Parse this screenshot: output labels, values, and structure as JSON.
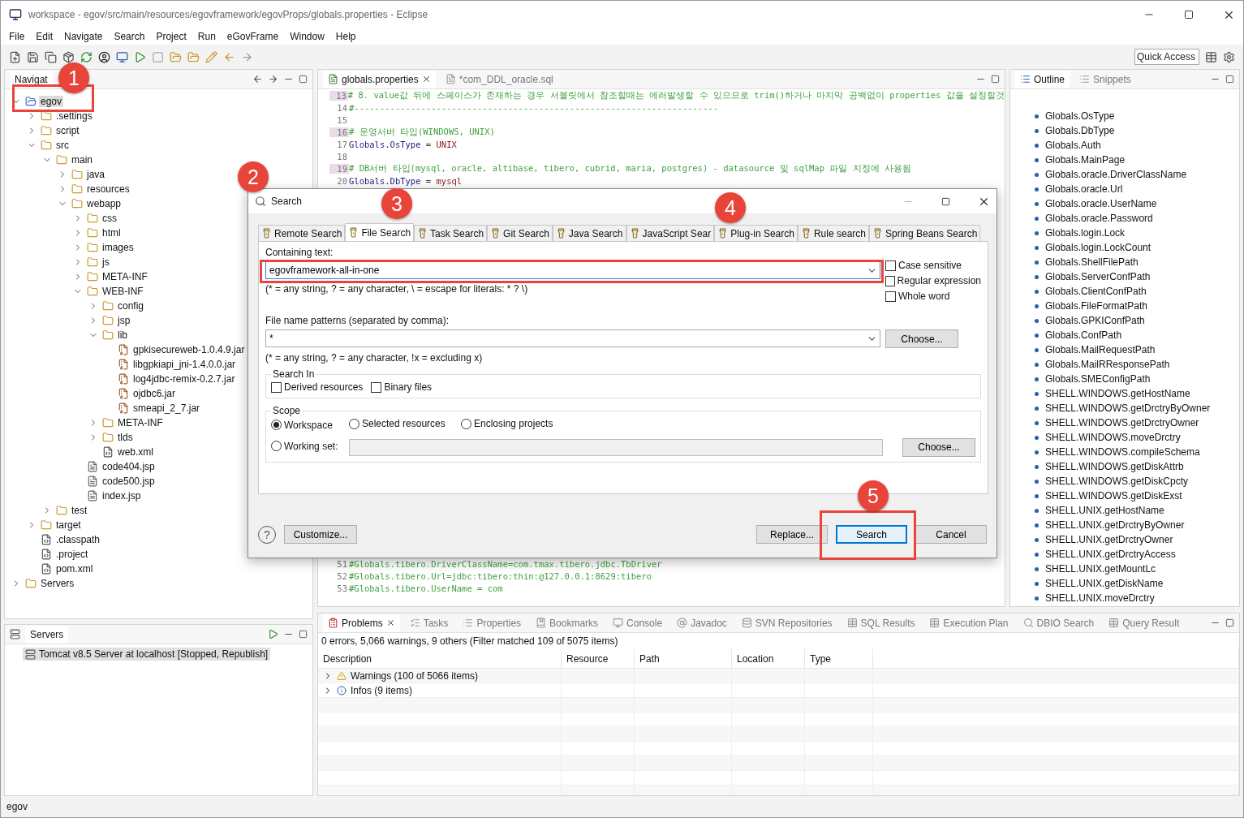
{
  "window": {
    "title": "workspace - egov/src/main/resources/egovframework/egovProps/globals.properties - Eclipse"
  },
  "menu": [
    "File",
    "Edit",
    "Navigate",
    "Search",
    "Project",
    "Run",
    "eGovFrame",
    "Window",
    "Help"
  ],
  "quick_access": {
    "placeholder": "Quick Access"
  },
  "navigator": {
    "tab": "Navigat",
    "tree": [
      {
        "label": "egov",
        "kind": "project",
        "expanded": true,
        "selected": true,
        "children": [
          {
            "label": ".settings",
            "kind": "folder",
            "expanded": false
          },
          {
            "label": "script",
            "kind": "folder",
            "expanded": false
          },
          {
            "label": "src",
            "kind": "folder",
            "expanded": true,
            "children": [
              {
                "label": "main",
                "kind": "folder",
                "expanded": true,
                "children": [
                  {
                    "label": "java",
                    "kind": "folder",
                    "expanded": false
                  },
                  {
                    "label": "resources",
                    "kind": "folder",
                    "expanded": false
                  },
                  {
                    "label": "webapp",
                    "kind": "folder",
                    "expanded": true,
                    "children": [
                      {
                        "label": "css",
                        "kind": "folder",
                        "expanded": false
                      },
                      {
                        "label": "html",
                        "kind": "folder",
                        "expanded": false
                      },
                      {
                        "label": "images",
                        "kind": "folder",
                        "expanded": false
                      },
                      {
                        "label": "js",
                        "kind": "folder",
                        "expanded": false
                      },
                      {
                        "label": "META-INF",
                        "kind": "folder",
                        "expanded": false
                      },
                      {
                        "label": "WEB-INF",
                        "kind": "folder",
                        "expanded": true,
                        "children": [
                          {
                            "label": "config",
                            "kind": "folder",
                            "expanded": false
                          },
                          {
                            "label": "jsp",
                            "kind": "folder",
                            "expanded": false
                          },
                          {
                            "label": "lib",
                            "kind": "folder",
                            "expanded": true,
                            "children": [
                              {
                                "label": "gpkisecureweb-1.0.4.9.jar",
                                "kind": "jar"
                              },
                              {
                                "label": "libgpkiapi_jni-1.4.0.0.jar",
                                "kind": "jar"
                              },
                              {
                                "label": "log4jdbc-remix-0.2.7.jar",
                                "kind": "jar"
                              },
                              {
                                "label": "ojdbc6.jar",
                                "kind": "jar"
                              },
                              {
                                "label": "smeapi_2_7.jar",
                                "kind": "jar"
                              }
                            ]
                          },
                          {
                            "label": "META-INF",
                            "kind": "folder",
                            "expanded": false
                          },
                          {
                            "label": "tlds",
                            "kind": "folder",
                            "expanded": false
                          },
                          {
                            "label": "web.xml",
                            "kind": "xml"
                          }
                        ]
                      },
                      {
                        "label": "code404.jsp",
                        "kind": "file"
                      },
                      {
                        "label": "code500.jsp",
                        "kind": "file"
                      },
                      {
                        "label": "index.jsp",
                        "kind": "file"
                      }
                    ]
                  }
                ]
              },
              {
                "label": "test",
                "kind": "folder",
                "expanded": false
              }
            ]
          },
          {
            "label": "target",
            "kind": "folder",
            "expanded": false
          },
          {
            "label": ".classpath",
            "kind": "xml"
          },
          {
            "label": ".project",
            "kind": "xml"
          },
          {
            "label": "pom.xml",
            "kind": "xml"
          }
        ]
      },
      {
        "label": "Servers",
        "kind": "folder",
        "expanded": false
      }
    ]
  },
  "editor": {
    "tabs": [
      {
        "label": "globals.properties",
        "selected": true
      },
      {
        "label": "*com_DDL_oracle.sql",
        "selected": false
      }
    ],
    "top_lines": [
      {
        "number": "13",
        "kind": "comment",
        "marked": true,
        "text": "#   8.  value값 뒤에 스페이스가 존재하는 경우 서블릿에서 참조할때는 에러발생할 수 있으므로 trim()하거나 마지막 공백없이 properties 값을 설정할것"
      },
      {
        "number": "14",
        "kind": "comment",
        "marked": false,
        "text": "#-----------------------------------------------------------------------"
      },
      {
        "number": "15",
        "kind": "blank",
        "marked": false
      },
      {
        "number": "16",
        "kind": "comment",
        "marked": true,
        "text": "# 운영서버 타입(WINDOWS, UNIX)"
      },
      {
        "number": "17",
        "kind": "property",
        "marked": false,
        "key": "Globals.OsType",
        "sep": " = ",
        "value": "UNIX"
      },
      {
        "number": "18",
        "kind": "blank",
        "marked": false
      },
      {
        "number": "19",
        "kind": "comment",
        "marked": true,
        "text": "# DB서버 타입(mysql, oracle, altibase, tibero, cubrid, maria, postgres) - datasource 및 sqlMap 파일 지정에 사용됨"
      },
      {
        "number": "20",
        "kind": "property",
        "marked": false,
        "key": "Globals.DbType",
        "sep": " = ",
        "value": "mysql"
      }
    ],
    "bottom_lines": [
      {
        "number": "51",
        "kind": "comment",
        "marked": false,
        "text": "#Globals.tibero.DriverClassName=com.tmax.tibero.jdbc.TbDriver"
      },
      {
        "number": "52",
        "kind": "comment",
        "marked": false,
        "text": "#Globals.tibero.Url=jdbc:tibero:thin:@127.0.0.1:8629:tibero"
      },
      {
        "number": "53",
        "kind": "comment",
        "marked": false,
        "text": "#Globals.tibero.UserName = com"
      }
    ]
  },
  "outline": {
    "tabs": [
      {
        "label": "Outline",
        "selected": true
      },
      {
        "label": "Snippets",
        "selected": false
      }
    ],
    "items": [
      "Globals.OsType",
      "Globals.DbType",
      "Globals.Auth",
      "Globals.MainPage",
      "Globals.oracle.DriverClassName",
      "Globals.oracle.Url",
      "Globals.oracle.UserName",
      "Globals.oracle.Password",
      "Globals.login.Lock",
      "Globals.login.LockCount",
      "Globals.ShellFilePath",
      "Globals.ServerConfPath",
      "Globals.ClientConfPath",
      "Globals.FileFormatPath",
      "Globals.GPKIConfPath",
      "Globals.ConfPath",
      "Globals.MailRequestPath",
      "Globals.MailRResponsePath",
      "Globals.SMEConfigPath",
      "SHELL.WINDOWS.getHostName",
      "SHELL.WINDOWS.getDrctryByOwner",
      "SHELL.WINDOWS.getDrctryOwner",
      "SHELL.WINDOWS.moveDrctry",
      "SHELL.WINDOWS.compileSchema",
      "SHELL.WINDOWS.getDiskAttrb",
      "SHELL.WINDOWS.getDiskCpcty",
      "SHELL.WINDOWS.getDiskExst",
      "SHELL.UNIX.getHostName",
      "SHELL.UNIX.getDrctryByOwner",
      "SHELL.UNIX.getDrctryOwner",
      "SHELL.UNIX.getDrctryAccess",
      "SHELL.UNIX.getMountLc",
      "SHELL.UNIX.getDiskName",
      "SHELL.UNIX.moveDrctry"
    ]
  },
  "servers": {
    "tab": "Servers",
    "rows": [
      {
        "label": "Tomcat v8.5 Server at localhost  [Stopped, Republish]",
        "selected": true
      }
    ]
  },
  "problems": {
    "tabs": [
      {
        "label": "Problems",
        "selected": true
      },
      {
        "label": "Tasks",
        "selected": false
      },
      {
        "label": "Properties",
        "selected": false
      },
      {
        "label": "Bookmarks",
        "selected": false
      },
      {
        "label": "Console",
        "selected": false
      },
      {
        "label": "Javadoc",
        "selected": false
      },
      {
        "label": "SVN Repositories",
        "selected": false
      },
      {
        "label": "SQL Results",
        "selected": false
      },
      {
        "label": "Execution Plan",
        "selected": false
      },
      {
        "label": "DBIO Search",
        "selected": false
      },
      {
        "label": "Query Result",
        "selected": false
      }
    ],
    "summary": "0 errors, 5,066 warnings, 9 others (Filter matched 109 of 5075 items)",
    "columns": [
      "Description",
      "Resource",
      "Path",
      "Location",
      "Type"
    ],
    "rows": [
      {
        "kind": "warning",
        "label": "Warnings (100 of 5066 items)",
        "expanded": false
      },
      {
        "kind": "info",
        "label": "Infos (9 items)",
        "expanded": false
      }
    ]
  },
  "dialog": {
    "title": "Search",
    "tabs": [
      {
        "label": "Remote Search",
        "selected": false
      },
      {
        "label": "File Search",
        "selected": true
      },
      {
        "label": "Task Search",
        "selected": false
      },
      {
        "label": "Git Search",
        "selected": false
      },
      {
        "label": "Java Search",
        "selected": false
      },
      {
        "label": "JavaScript Sear",
        "selected": false
      },
      {
        "label": "Plug-in Search",
        "selected": false
      },
      {
        "label": "Rule search",
        "selected": false
      },
      {
        "label": "Spring Beans Search",
        "selected": false
      }
    ],
    "containing_label": "Containing text:",
    "containing_value": "egovframework-all-in-one",
    "containing_hint": "(* = any string, ? = any character, \\ = escape for literals: * ? \\)",
    "options": [
      {
        "label": "Case sensitive",
        "checked": false
      },
      {
        "label": "Regular expression",
        "checked": false
      },
      {
        "label": "Whole word",
        "checked": false
      }
    ],
    "patterns_label": "File name patterns (separated by comma):",
    "patterns_value": "*",
    "choose": "Choose...",
    "patterns_hint": "(* = any string, ? = any character, !x = excluding x)",
    "search_in": {
      "title": "Search In",
      "options": [
        {
          "label": "Derived resources",
          "checked": false
        },
        {
          "label": "Binary files",
          "checked": false
        }
      ]
    },
    "scope": {
      "title": "Scope",
      "options": [
        {
          "label": "Workspace",
          "selected": true
        },
        {
          "label": "Selected resources",
          "selected": false
        },
        {
          "label": "Enclosing projects",
          "selected": false
        },
        {
          "label": "Working set:",
          "selected": false
        }
      ],
      "choose": "Choose..."
    },
    "help": "?",
    "customize": "Customize...",
    "buttons": [
      {
        "label": "Replace...",
        "default": false
      },
      {
        "label": "Search",
        "default": true
      },
      {
        "label": "Cancel",
        "default": false
      }
    ]
  },
  "annotations": [
    "1",
    "2",
    "3",
    "4",
    "5"
  ],
  "status_bar": "egov"
}
